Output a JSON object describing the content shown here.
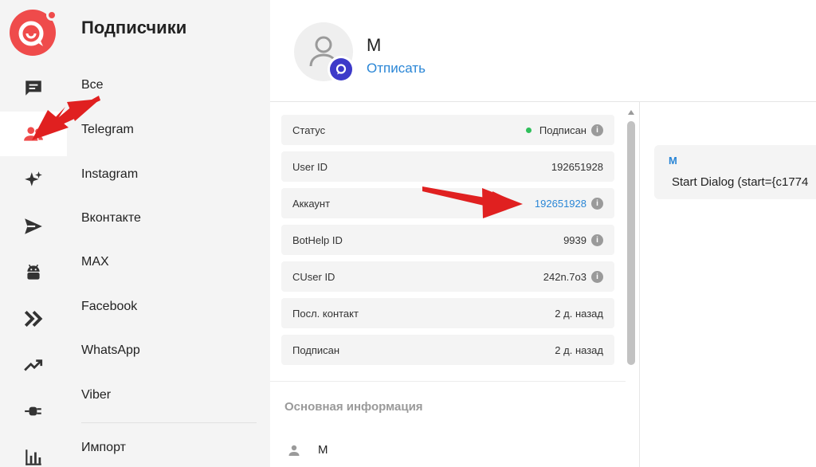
{
  "nav": {
    "items": [
      {
        "icon": "chat-icon"
      },
      {
        "icon": "users-icon",
        "active": true
      },
      {
        "icon": "sparkles-icon"
      },
      {
        "icon": "send-icon"
      },
      {
        "icon": "android-icon"
      },
      {
        "icon": "chevrons-right-icon"
      },
      {
        "icon": "trending-up-icon"
      },
      {
        "icon": "plug-icon"
      },
      {
        "icon": "bar-chart-icon"
      }
    ]
  },
  "subnav": {
    "title": "Подписчики",
    "items": [
      "Все",
      "Telegram",
      "Instagram",
      "Вконтакте",
      "MAX",
      "Facebook",
      "WhatsApp",
      "Viber"
    ],
    "import_label": "Импорт"
  },
  "header": {
    "name": "М",
    "unsubscribe_label": "Отписать"
  },
  "info": {
    "rows": [
      {
        "label": "Статус",
        "value": "Подписан",
        "status_dot": true,
        "info_icon": true
      },
      {
        "label": "User ID",
        "value": "192651928"
      },
      {
        "label": "Аккаунт",
        "value": "192651928",
        "link": true,
        "info_icon": true
      },
      {
        "label": "BotHelp ID",
        "value": "9939",
        "info_icon": true
      },
      {
        "label": "CUser ID",
        "value": "242n.7o3",
        "info_icon": true
      },
      {
        "label": "Посл. контакт",
        "value": "2 д. назад"
      },
      {
        "label": "Подписан",
        "value": "2 д. назад"
      }
    ],
    "section_title": "Основная информация",
    "person_name": "М"
  },
  "dialog": {
    "author": "М",
    "text": "Start Dialog (start={c1774"
  },
  "colors": {
    "brand": "#ef4b4b",
    "accent_blue": "#2a86d6",
    "status_green": "#2fbf5b",
    "annotation_red": "#e02020"
  }
}
